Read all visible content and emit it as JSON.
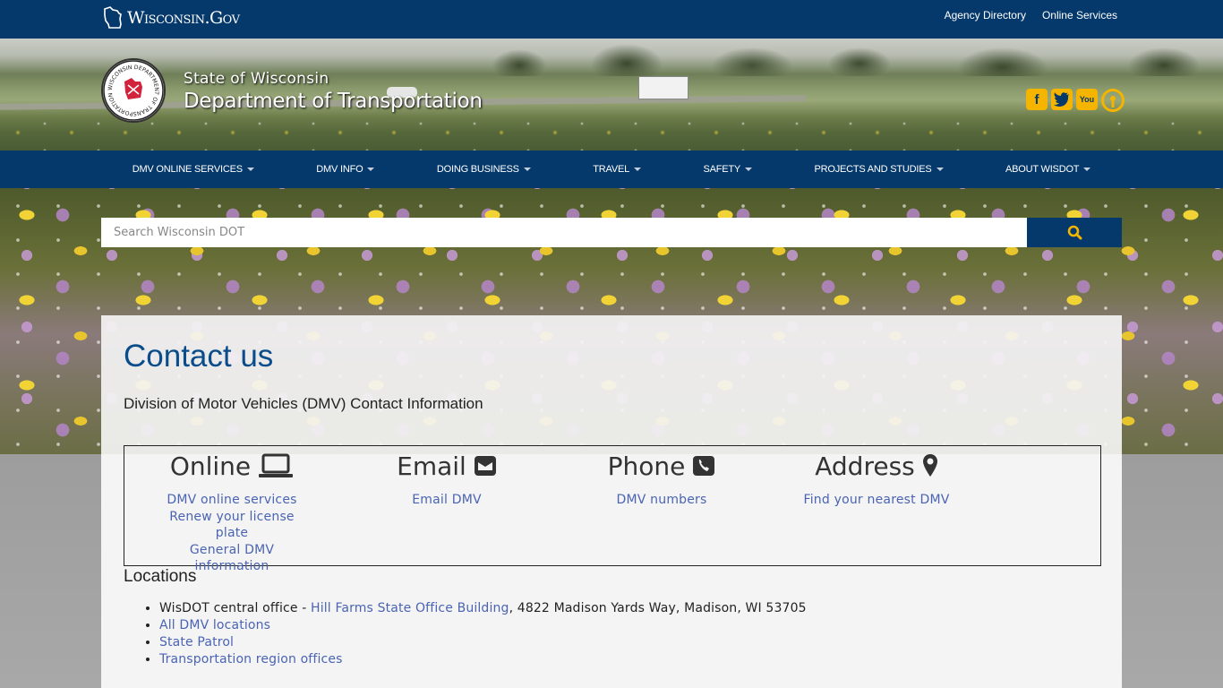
{
  "topbar": {
    "logo_text": "Wisconsin.Gov",
    "links": [
      "Agency Directory",
      "Online Services"
    ]
  },
  "header": {
    "seal_text": "WISCONSIN DEPARTMENT OF TRANSPORTATION",
    "agency_line1": "State of Wisconsin",
    "agency_line2": "Department of Transportation",
    "social_icons": [
      "facebook-icon",
      "twitter-icon",
      "youtube-icon",
      "podcast-icon"
    ]
  },
  "nav": {
    "items": [
      "DMV ONLINE SERVICES",
      "DMV INFO",
      "DOING BUSINESS",
      "TRAVEL",
      "SAFETY",
      "PROJECTS AND STUDIES",
      "ABOUT WISDOT"
    ]
  },
  "search": {
    "placeholder": "Search Wisconsin DOT",
    "button_icon": "search-icon"
  },
  "main": {
    "title": "Contact us",
    "subtitle": "Division of Motor Vehicles (DMV) Contact Information",
    "contact_columns": [
      {
        "label": "Online",
        "icon": "laptop-icon",
        "links": [
          "DMV online services",
          "Renew your license plate",
          "General DMV information"
        ]
      },
      {
        "label": "Email",
        "icon": "envelope-icon",
        "links": [
          "Email DMV"
        ]
      },
      {
        "label": "Phone",
        "icon": "phone-icon",
        "links": [
          "DMV numbers"
        ]
      },
      {
        "label": "Address",
        "icon": "map-marker-icon",
        "links": [
          "Find your nearest DMV"
        ]
      }
    ],
    "locations_title": "Locations",
    "locations": {
      "central_prefix": "WisDOT central office - ",
      "central_link": "Hill Farms State Office Building",
      "central_suffix": ", 4822 Madison Yards Way, Madison, WI 53705",
      "links": [
        "All DMV locations",
        "State Patrol",
        "Transportation region offices"
      ]
    }
  },
  "colors": {
    "navy": "#05396b",
    "gold": "#f4b400",
    "link": "#4a64b3",
    "title": "#0b4c8a"
  }
}
